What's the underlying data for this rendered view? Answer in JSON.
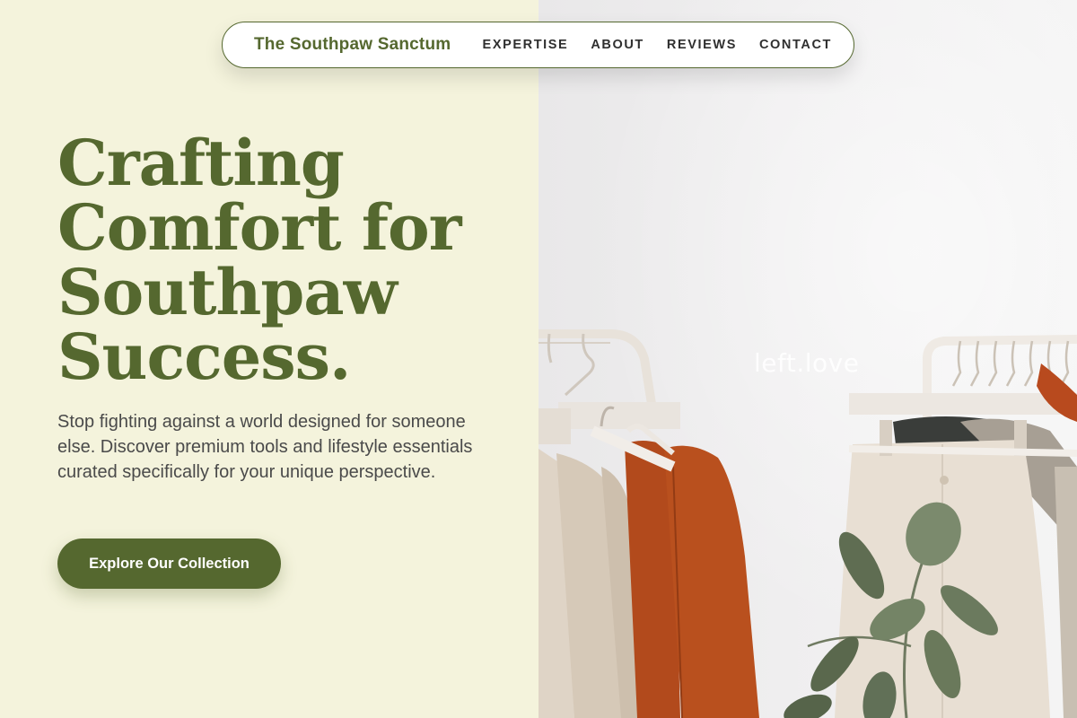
{
  "nav": {
    "brand": "The Southpaw Sanctum",
    "links": [
      {
        "label": "EXPERTISE"
      },
      {
        "label": "ABOUT"
      },
      {
        "label": "REVIEWS"
      },
      {
        "label": "CONTACT"
      }
    ]
  },
  "hero": {
    "title": "Crafting Comfort for Southpaw Success.",
    "subtitle": "Stop fighting against a world designed for someone else. Discover premium tools and lifestyle essentials curated specifically for your unique perspective.",
    "cta_label": "Explore Our Collection"
  },
  "image": {
    "watermark": "left.love"
  },
  "colors": {
    "brand_green": "#55682f",
    "cream_background": "#f4f3dc",
    "body_text": "#4a4a4a"
  }
}
